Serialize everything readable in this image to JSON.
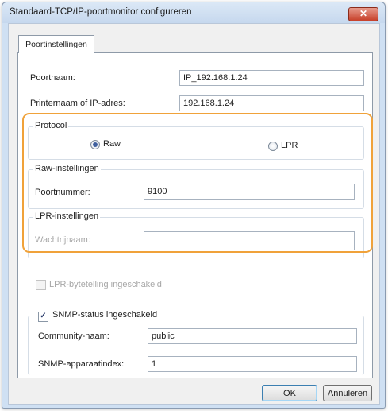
{
  "window": {
    "title": "Standaard-TCP/IP-poortmonitor configureren",
    "close_glyph": "✕"
  },
  "tabs": [
    {
      "label": "Poortinstellingen"
    }
  ],
  "port_name": {
    "label": "Poortnaam:",
    "value": "IP_192.168.1.24"
  },
  "printer_address": {
    "label": "Printernaam of IP-adres:",
    "value": "192.168.1.24"
  },
  "protocol": {
    "legend": "Protocol",
    "options": [
      {
        "label": "Raw",
        "checked": true
      },
      {
        "label": "LPR",
        "checked": false
      }
    ]
  },
  "raw_settings": {
    "legend": "Raw-instellingen",
    "port_number_label": "Poortnummer:",
    "port_number_value": "9100"
  },
  "lpr_settings": {
    "legend": "LPR-instellingen",
    "queue_name_label": "Wachtrijnaam:",
    "queue_name_value": ""
  },
  "lpr_byte_counting": {
    "label": "LPR-bytetelling ingeschakeld",
    "checked": false,
    "enabled": false
  },
  "snmp": {
    "legend": "SNMP-status ingeschakeld",
    "checked": true,
    "check_glyph": "✓",
    "community_label": "Community-naam:",
    "community_value": "public",
    "device_index_label": "SNMP-apparaatindex:",
    "device_index_value": "1"
  },
  "buttons": {
    "ok": "OK",
    "cancel": "Annuleren"
  },
  "colors": {
    "highlight": "#f0a23a",
    "title_bar": "#c6d8ee",
    "close_button": "#c7402a"
  }
}
